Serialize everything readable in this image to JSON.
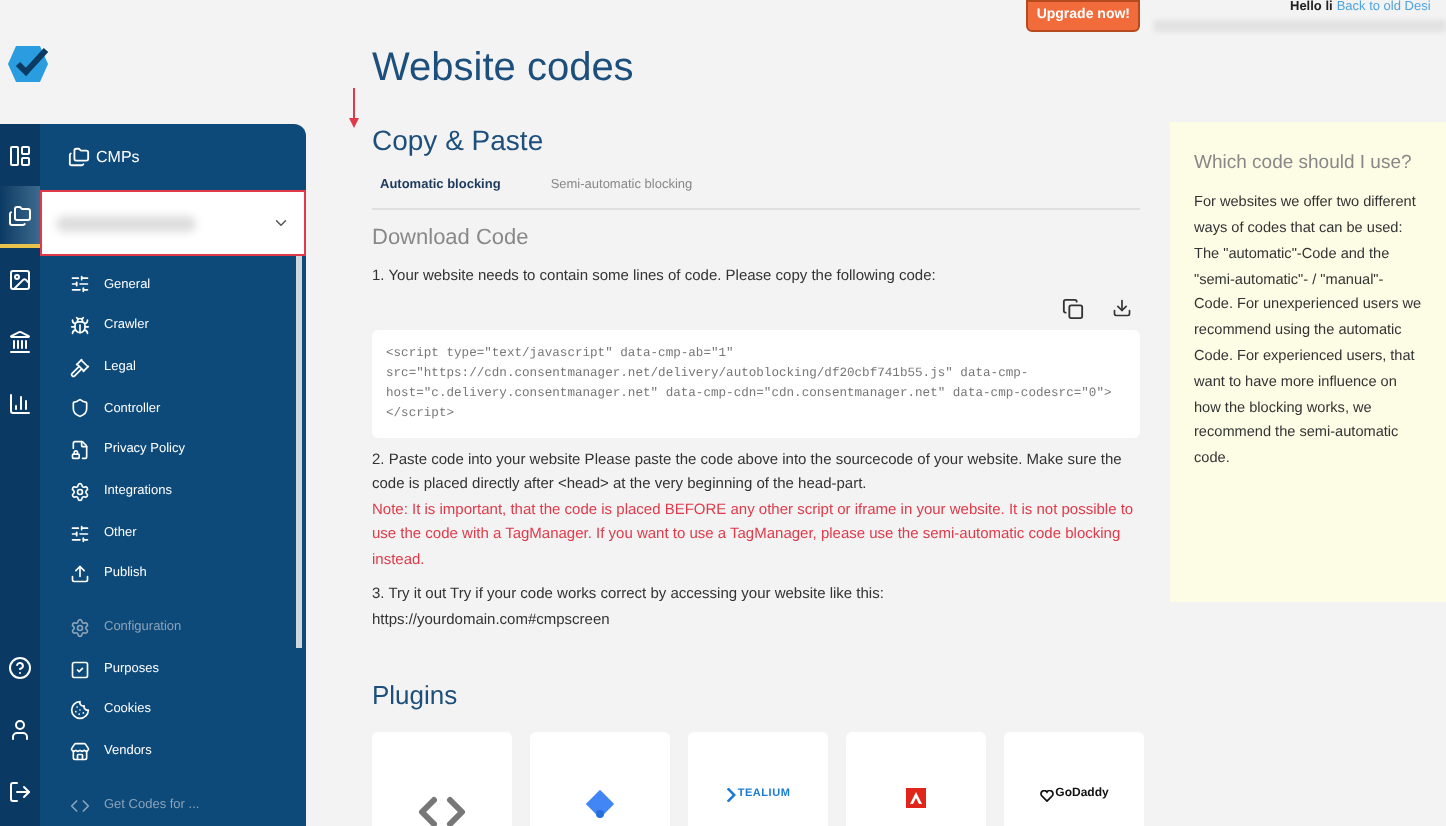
{
  "header": {
    "upgrade_button": "Upgrade now!",
    "greeting": "Hello li",
    "back_link": "Back to old Desi"
  },
  "rail": {
    "top": [
      {
        "selected": false
      },
      {
        "selected": true
      },
      {
        "selected": false
      },
      {
        "selected": false
      },
      {
        "selected": false
      }
    ]
  },
  "sidebar": {
    "title": "CMPs",
    "items": [
      {
        "kind": "item",
        "label": "General"
      },
      {
        "kind": "item",
        "label": "Crawler"
      },
      {
        "kind": "item",
        "label": "Legal"
      },
      {
        "kind": "item",
        "label": "Controller"
      },
      {
        "kind": "item",
        "label": "Privacy Policy"
      },
      {
        "kind": "item",
        "label": "Integrations"
      },
      {
        "kind": "item",
        "label": "Other"
      },
      {
        "kind": "item",
        "label": "Publish"
      },
      {
        "kind": "header",
        "label": "Configuration"
      },
      {
        "kind": "item",
        "label": "Purposes"
      },
      {
        "kind": "item",
        "label": "Cookies"
      },
      {
        "kind": "item",
        "label": "Vendors"
      },
      {
        "kind": "header",
        "label": "Get Codes for ..."
      }
    ]
  },
  "page": {
    "title": "Website codes",
    "section": "Copy & Paste",
    "tabs": [
      {
        "label": "Automatic blocking",
        "selected": true
      },
      {
        "label": "Semi-automatic blocking",
        "selected": false
      }
    ],
    "subtitle": "Download Code",
    "step_1": "1. Your website needs to contain some lines of code. Please copy the following code:",
    "code": "<script type=\"text/javascript\" data-cmp-ab=\"1\" src=\"https://cdn.consentmanager.net/delivery/autoblocking/df20cbf741b55.js\" data-cmp-host=\"c.delivery.consentmanager.net\" data-cmp-cdn=\"cdn.consentmanager.net\" data-cmp-codesrc=\"0\"></script>",
    "step_2": "2. Paste code into your website Please paste the code above into the sourcecode of your website. Make sure the code is placed directly after <head> at the very beginning of the head-part.",
    "note": "Note: It is important, that the code is placed BEFORE any other script or iframe in your website. It is not possible to use the code with a TagManager. If you want to use a TagManager, please use the semi-automatic code blocking instead.",
    "step_3": "3. Try it out Try if your code works correct by accessing your website like this:",
    "step_3_url": "https://yourdomain.com#cmpscreen",
    "plugins_title": "Plugins",
    "plugins": [
      {
        "kind": "code"
      },
      {
        "kind": "tagmanager"
      },
      {
        "kind": "tealium",
        "name": "TEALIUM"
      },
      {
        "kind": "adobe"
      },
      {
        "kind": "godaddy",
        "name": "GoDaddy"
      }
    ]
  },
  "help": {
    "title": "Which code should I use?",
    "text": "For websites we offer two different ways of codes that can be used: The \"automatic\"-Code and the \"semi-automatic\"- / \"manual\"-Code. For unexperienced users we recommend using the automatic Code. For experienced users, that want to have more influence on how the blocking works, we recommend the semi-automatic code."
  }
}
